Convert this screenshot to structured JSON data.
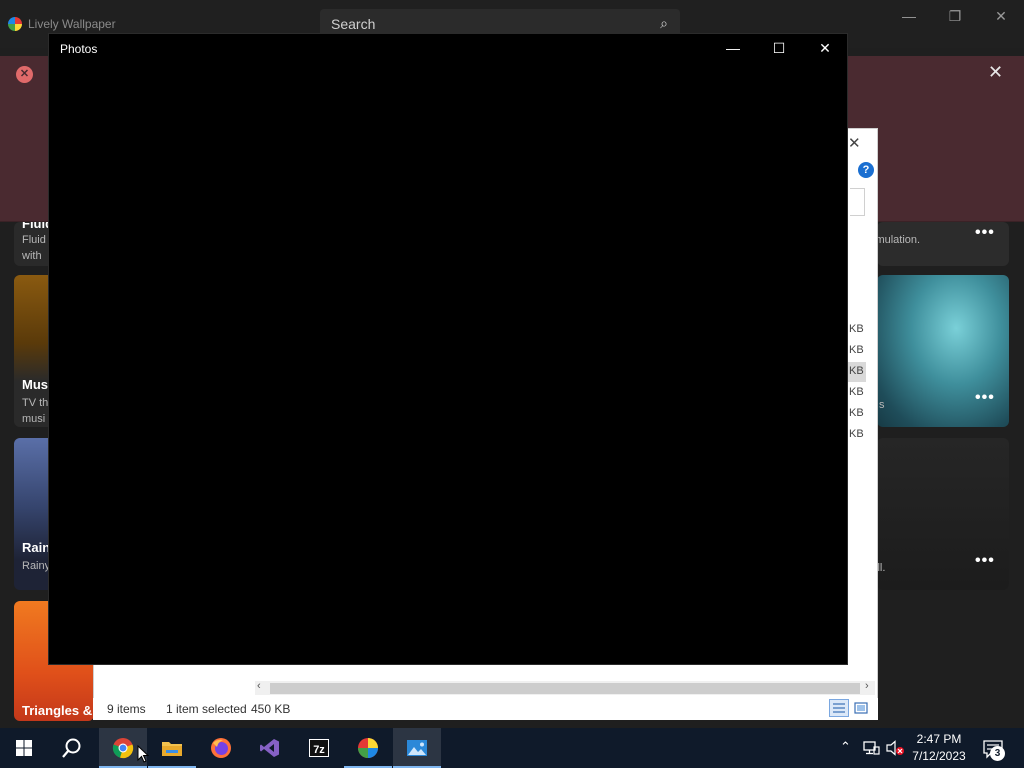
{
  "lively": {
    "app_title": "Lively Wallpaper",
    "search_placeholder": "Search",
    "controls": {
      "minimize": "—",
      "maximize": "❐",
      "close": "✕"
    },
    "banner": {
      "close": "✕"
    },
    "cards": [
      {
        "title": "Fluid",
        "desc_line1": "Fluid",
        "desc_line2": "with",
        "right_desc": "imulation."
      },
      {
        "title": "Mus",
        "desc_line1": "TV th",
        "desc_line2": "musi",
        "right_desc": "s"
      },
      {
        "title": "Rain",
        "desc_line1": "Rainy",
        "desc_line2": "",
        "right_desc": "ill."
      },
      {
        "title": "Triangles &",
        "desc_line1": "",
        "desc_line2": "",
        "right_desc": ""
      }
    ],
    "more_glyph": "•••"
  },
  "explorer": {
    "close": "✕",
    "help": "?",
    "file_sizes": [
      "KB",
      "KB",
      "KB",
      "KB",
      "KB",
      "KB"
    ],
    "scroll_left": "‹",
    "scroll_right": "›",
    "status": {
      "items": "9 items",
      "selected": "1 item selected",
      "size": "450 KB"
    }
  },
  "photos": {
    "title": "Photos",
    "controls": {
      "minimize": "—",
      "maximize": "☐",
      "close": "✕"
    }
  },
  "taskbar": {
    "apps": [
      "start",
      "search",
      "chrome",
      "file-explorer",
      "firefox",
      "visual-studio",
      "7zip",
      "lively",
      "photos"
    ],
    "tray": {
      "chevron": "⌃",
      "notifications_count": "3"
    },
    "clock": {
      "time": "2:47 PM",
      "date": "7/12/2023"
    }
  },
  "colors": {
    "banner": "#4a2a30",
    "accent": "#7fb6f0",
    "taskbar": "#0f1a2a"
  }
}
